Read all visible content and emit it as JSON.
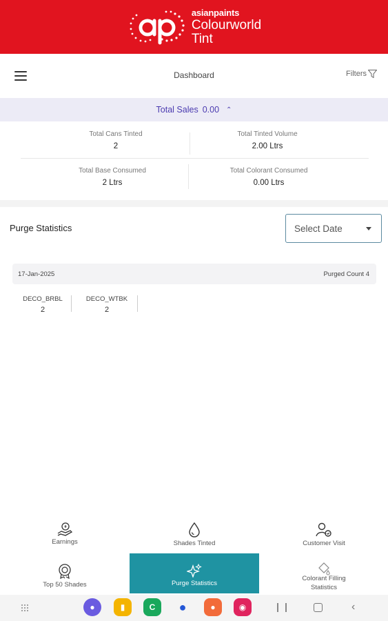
{
  "brand": {
    "line1": "asianpaints",
    "line2": "Colourworld",
    "line3": "Tint",
    "color": "#e1141f"
  },
  "topbar": {
    "title": "Dashboard",
    "filters_label": "Filters"
  },
  "sales": {
    "label": "Total Sales",
    "value": "0.00"
  },
  "stats": {
    "cans_tinted": {
      "label": "Total Cans Tinted",
      "value": "2"
    },
    "tinted_volume": {
      "label": "Total Tinted Volume",
      "value": "2.00 Ltrs"
    },
    "base_consumed": {
      "label": "Total Base Consumed",
      "value": "2 Ltrs"
    },
    "colorant_consumed": {
      "label": "Total Colorant Consumed",
      "value": "0.00 Ltrs"
    }
  },
  "purge": {
    "title": "Purge Statistics",
    "select_placeholder": "Select Date",
    "entry": {
      "date": "17-Jan-2025",
      "count_label": "Purged Count 4"
    },
    "shades": [
      {
        "name": "DECO_BRBL",
        "count": "2"
      },
      {
        "name": "DECO_WTBK",
        "count": "2"
      }
    ]
  },
  "bottom_nav": {
    "earnings": "Earnings",
    "shades_tinted": "Shades Tinted",
    "customer_visit": "Customer Visit",
    "top50": "Top 50 Shades",
    "purge_stats": "Purge Statistics",
    "colorant_filling": "Colorant Filling Statistics",
    "active_color": "#1f93a2"
  },
  "system_dock": [
    "internet-icon",
    "files-icon",
    "phone-icon",
    "messages-icon",
    "contacts-icon",
    "camera-icon"
  ]
}
